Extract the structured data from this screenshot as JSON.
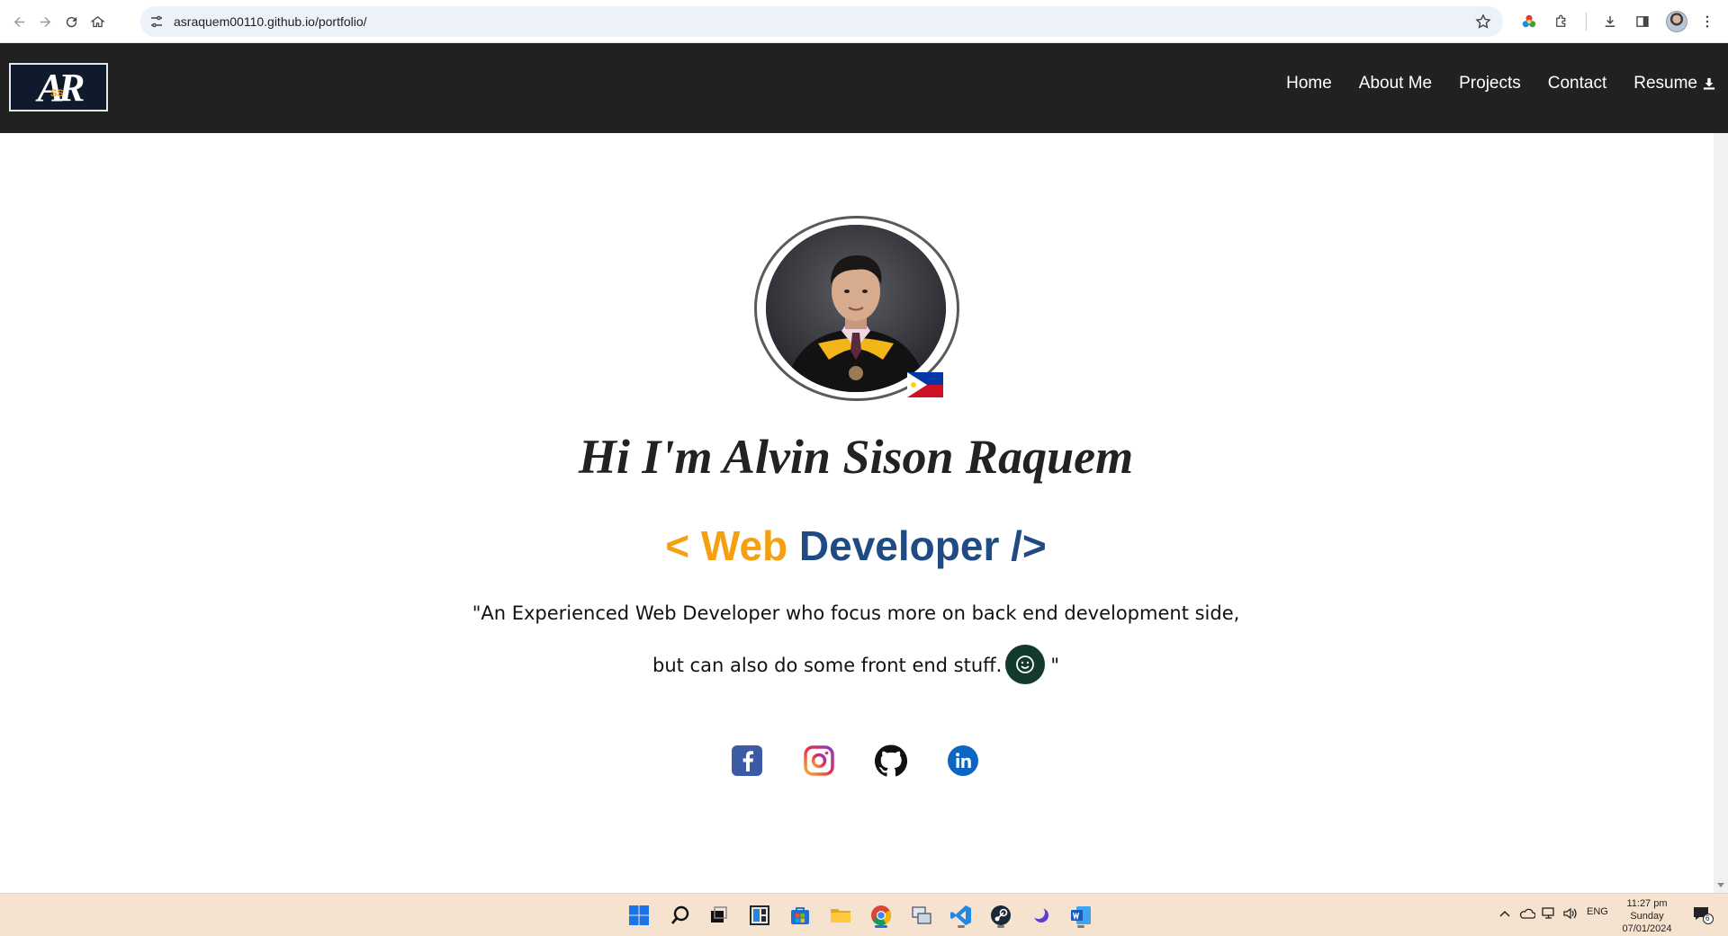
{
  "browser": {
    "url": "asraquem00110.github.io/portfolio/"
  },
  "site": {
    "logo_text": "AR",
    "logo_subtext": "SS",
    "nav": [
      {
        "label": "Home"
      },
      {
        "label": "About Me"
      },
      {
        "label": "Projects"
      },
      {
        "label": "Contact"
      },
      {
        "label": "Resume"
      }
    ]
  },
  "hero": {
    "title": "Hi I'm Alvin Sison Raquem",
    "role_open": "< Web",
    "role_close": "Developer />",
    "quote_line1": "\"An Experienced Web Developer who focus more on back end development side,",
    "quote_line2": "but can also do some front end stuff.",
    "quote_end": "\"",
    "socials": [
      {
        "name": "facebook",
        "icon": "facebook-icon"
      },
      {
        "name": "instagram",
        "icon": "instagram-icon"
      },
      {
        "name": "github",
        "icon": "github-icon"
      },
      {
        "name": "linkedin",
        "icon": "linkedin-icon"
      }
    ]
  },
  "taskbar": {
    "language": "ENG",
    "time": "11:27 pm",
    "day": "Sunday",
    "date": "07/01/2024",
    "notification_count": "6"
  },
  "colors": {
    "navbar_bg": "#212121",
    "accent_orange": "#f5a00f",
    "accent_blue": "#1f4a82",
    "taskbar_bg": "#f6e3cf"
  }
}
